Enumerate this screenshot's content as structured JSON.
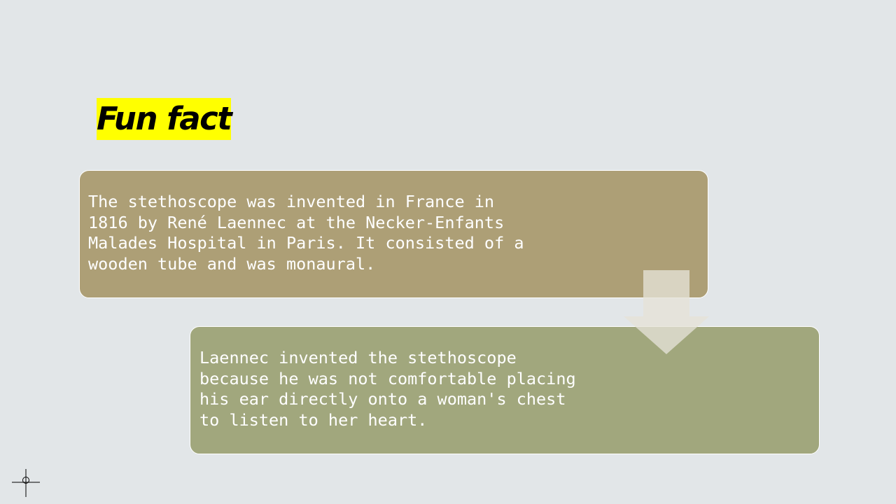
{
  "slide": {
    "title": "Fun fact",
    "title_highlight_color": "#ffff00",
    "facts": [
      {
        "text": "The stethoscope was invented in France in\n1816 by René Laennec at the Necker-Enfants\nMalades Hospital in Paris. It consisted of a\nwooden tube and was monaural.",
        "color": "#ad9f76"
      },
      {
        "text": "Laennec invented the stethoscope\nbecause he was not comfortable placing\nhis ear directly onto a woman's chest\nto listen to her heart.",
        "color": "#a1a77d"
      }
    ],
    "connector_icon": "down-arrow-icon",
    "cursor_icon": "crosshair-cursor-icon"
  }
}
